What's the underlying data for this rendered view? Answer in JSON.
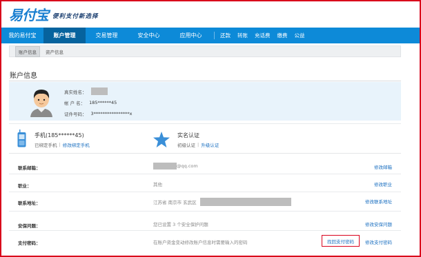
{
  "logo": {
    "name": "易付宝",
    "slogan": "便利支付新选择"
  },
  "nav": {
    "main": [
      "我的易付宝",
      "账户管理",
      "交易管理",
      "安全中心",
      "应用中心"
    ],
    "active": "账户管理",
    "quick": [
      "还款",
      "转账",
      "充话费",
      "缴费",
      "公益"
    ]
  },
  "subtabs": [
    "账户信息",
    "资产信息"
  ],
  "section_title": "账户信息",
  "profile": {
    "real_name_label": "真实姓名：",
    "account_label": "帐 户 名：",
    "account_value": "185******45",
    "id_label": "证件号码：",
    "id_value": "3****************x"
  },
  "phone": {
    "title": "手机(185******45)",
    "status": "已绑定手机",
    "action": "修改绑定手机"
  },
  "realname": {
    "title": "实名认证",
    "status": "初级认证",
    "action": "升级认证"
  },
  "rows": {
    "email": {
      "label": "联系邮箱：",
      "value": "@qq.com",
      "action": "修改邮箱"
    },
    "job": {
      "label": "职业：",
      "value": "其他",
      "action": "修改职业"
    },
    "address": {
      "label": "联系地址：",
      "value": "江苏省  南京市  玄武区",
      "action": "修改联系地址"
    },
    "security": {
      "label": "安保问题：",
      "value": "您已设置 3 个安全保护问题",
      "action": "修改安保问题"
    },
    "paypwd": {
      "label": "支付密码：",
      "value": "在账户资金变动修改账户信息时需要输入的密码",
      "retrieve": "找回支付密码",
      "action": "修改支付密码"
    }
  },
  "colors": {
    "brand": "#0d8ad8",
    "nav_active": "#06639e",
    "highlight": "#d9001b",
    "link": "#1a6fc0"
  }
}
